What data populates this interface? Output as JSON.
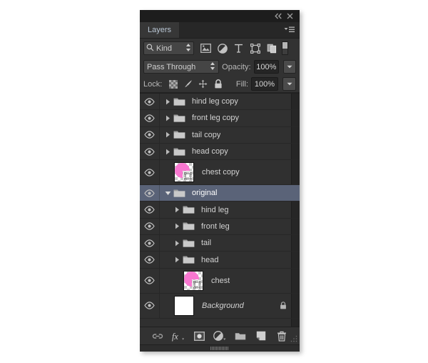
{
  "panel": {
    "title": "Layers",
    "collapse_icon": "collapse-double-arrow-icon",
    "close_icon": "close-icon",
    "menu_icon": "panel-menu-icon"
  },
  "filter": {
    "kind_label": "Kind",
    "search_icon": "search-icon",
    "stepper_icon": "updown-stepper-icon",
    "icons": [
      {
        "name": "filter-pixel-layers-icon",
        "title": "Pixel layers"
      },
      {
        "name": "filter-adjustment-layers-icon",
        "title": "Adjustment layers"
      },
      {
        "name": "filter-type-layers-icon",
        "title": "Type layers"
      },
      {
        "name": "filter-shape-layers-icon",
        "title": "Shape layers"
      },
      {
        "name": "filter-smart-objects-icon",
        "title": "Smart objects"
      }
    ],
    "toggle_name": "filter-enable-toggle"
  },
  "blend": {
    "mode": "Pass Through",
    "opacity_label": "Opacity:",
    "opacity_value": "100%",
    "fill_label": "Fill:",
    "fill_value": "100%"
  },
  "lock": {
    "label": "Lock:",
    "icons": [
      {
        "name": "lock-transparent-pixels-icon"
      },
      {
        "name": "lock-image-pixels-icon"
      },
      {
        "name": "lock-position-icon"
      },
      {
        "name": "lock-all-icon"
      }
    ]
  },
  "layers": [
    {
      "name": "hind leg copy",
      "type": "group",
      "indent": 0,
      "expanded": false,
      "visible": true,
      "selected": false,
      "locked": false
    },
    {
      "name": "front leg copy",
      "type": "group",
      "indent": 0,
      "expanded": false,
      "visible": true,
      "selected": false,
      "locked": false
    },
    {
      "name": "tail copy",
      "type": "group",
      "indent": 0,
      "expanded": false,
      "visible": true,
      "selected": false,
      "locked": false
    },
    {
      "name": "head copy",
      "type": "group",
      "indent": 0,
      "expanded": false,
      "visible": true,
      "selected": false,
      "locked": false
    },
    {
      "name": "chest copy",
      "type": "pixel",
      "indent": 0,
      "expanded": null,
      "visible": true,
      "selected": false,
      "locked": false
    },
    {
      "name": "original",
      "type": "group",
      "indent": 0,
      "expanded": true,
      "visible": true,
      "selected": true,
      "locked": false
    },
    {
      "name": "hind leg",
      "type": "group",
      "indent": 1,
      "expanded": false,
      "visible": true,
      "selected": false,
      "locked": false
    },
    {
      "name": "front leg",
      "type": "group",
      "indent": 1,
      "expanded": false,
      "visible": true,
      "selected": false,
      "locked": false
    },
    {
      "name": "tail",
      "type": "group",
      "indent": 1,
      "expanded": false,
      "visible": true,
      "selected": false,
      "locked": false
    },
    {
      "name": "head",
      "type": "group",
      "indent": 1,
      "expanded": false,
      "visible": true,
      "selected": false,
      "locked": false
    },
    {
      "name": "chest",
      "type": "pixel",
      "indent": 1,
      "expanded": null,
      "visible": true,
      "selected": false,
      "locked": false
    },
    {
      "name": "Background",
      "type": "background",
      "indent": 0,
      "expanded": null,
      "visible": true,
      "selected": false,
      "locked": true
    }
  ],
  "bottom_toolbar": [
    {
      "name": "link-layers-icon",
      "label": "Link layers"
    },
    {
      "name": "layer-style-fx-icon",
      "label": "fx"
    },
    {
      "name": "add-layer-mask-icon",
      "label": "Add layer mask"
    },
    {
      "name": "new-adjustment-layer-icon",
      "label": "New adjustment layer"
    },
    {
      "name": "new-group-icon",
      "label": "New group"
    },
    {
      "name": "new-layer-icon",
      "label": "New layer"
    },
    {
      "name": "delete-layer-icon",
      "label": "Delete layer"
    }
  ],
  "colors": {
    "panel_bg": "#323232",
    "list_bg": "#303030",
    "selected_row": "#5a6378",
    "text": "#d2d2d2",
    "thumb_art": "#f877d0",
    "tab_active": "#373737",
    "tab_text": "#b9c6d4"
  }
}
